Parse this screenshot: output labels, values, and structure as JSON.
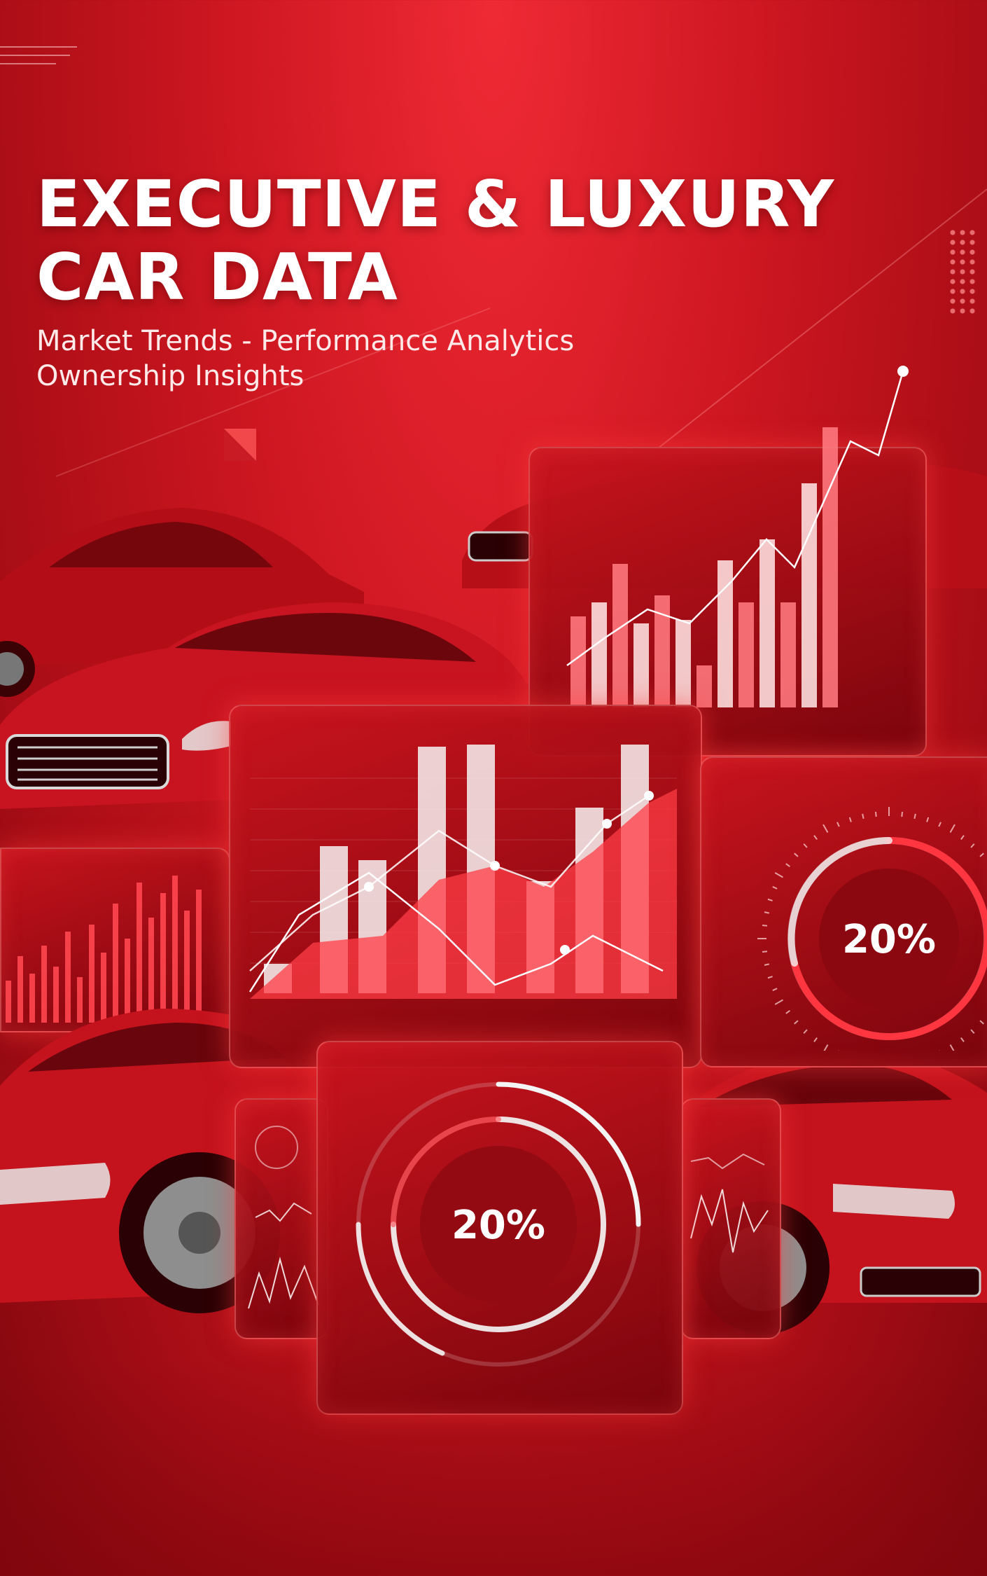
{
  "header": {
    "title_line1": "EXECUTIVE & LUXURY",
    "title_line2": "CAR DATA",
    "subtitle_line1": "Market Trends  -  Performance Analytics",
    "subtitle_line2": "Ownership Insights"
  },
  "gauges": {
    "right_label": "20%",
    "center_label": "20%"
  },
  "colors": {
    "background": "#cc1620",
    "accent": "#ff4a55",
    "text": "#ffffff"
  },
  "icons": [
    "sedan-car",
    "bar-chart",
    "line-chart",
    "circular-gauge"
  ]
}
